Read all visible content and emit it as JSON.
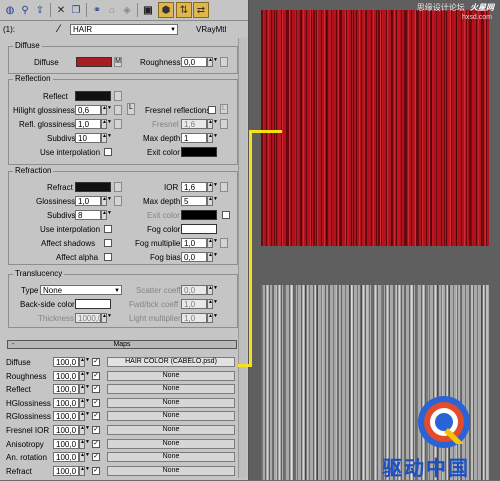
{
  "toolbar": {
    "icons": [
      "sphere-icon",
      "pick-icon",
      "put-icon",
      "delete-icon",
      "copy-icon",
      "unique-icon",
      "put-library-icon",
      "material-effects-icon",
      "show-map-icon",
      "show-end-result-icon",
      "go-parent-icon",
      "go-sibling-icon"
    ]
  },
  "material": {
    "slot": "(1):",
    "name": "HAIR",
    "type": "VRayMtl"
  },
  "diffuse": {
    "title": "Diffuse",
    "diffuse_label": "Diffuse",
    "diffuse_color": "#a61d22",
    "map_letter": "M",
    "roughness_label": "Roughness",
    "roughness_value": "0,0"
  },
  "reflection": {
    "title": "Reflection",
    "reflect_label": "Reflect",
    "reflect_color": "#111111",
    "hilight_label": "Hilight glossiness",
    "hilight_value": "0,6",
    "lock_letter": "L",
    "fresnel_label": "Fresnel reflections",
    "fresnel_lock": "L",
    "refl_gloss_label": "Refl. glossiness",
    "refl_gloss_value": "1,0",
    "fresnel_ior_label": "Fresnel IOR",
    "fresnel_ior_value": "1,6",
    "subdivs_label": "Subdivs",
    "subdivs_value": "10",
    "max_depth_label": "Max depth",
    "max_depth_value": "1",
    "use_interp_label": "Use interpolation",
    "exit_color_label": "Exit color",
    "exit_color": "#000000"
  },
  "refraction": {
    "title": "Refraction",
    "refract_label": "Refract",
    "refract_color": "#111111",
    "ior_label": "IOR",
    "ior_value": "1,6",
    "glossiness_label": "Glossiness",
    "glossiness_value": "1,0",
    "max_depth_label": "Max depth",
    "max_depth_value": "5",
    "subdivs_label": "Subdivs",
    "subdivs_value": "8",
    "exit_color_label": "Exit color",
    "exit_color": "#000000",
    "use_interp_label": "Use interpolation",
    "fog_color_label": "Fog color",
    "fog_color": "#ffffff",
    "affect_shadows_label": "Affect shadows",
    "fog_mult_label": "Fog multiplier",
    "fog_mult_value": "1,0",
    "affect_alpha_label": "Affect alpha",
    "fog_bias_label": "Fog bias",
    "fog_bias_value": "0,0"
  },
  "translucency": {
    "title": "Translucency",
    "type_label": "Type",
    "type_value": "None",
    "scatter_label": "Scatter coeff",
    "scatter_value": "0,0",
    "backside_label": "Back-side color",
    "backside_color": "#ffffff",
    "fwd_label": "Fwd/bck coeff",
    "fwd_value": "1,0",
    "thickness_label": "Thickness",
    "thickness_value": "1000,0",
    "light_mult_label": "Light multiplier",
    "light_mult_value": "1,0"
  },
  "maps": {
    "collapse": "-",
    "title": "Maps",
    "rows": [
      {
        "name": "Diffuse",
        "amount": "100,0",
        "map": "HAIR COLOR (CABELO.psd)"
      },
      {
        "name": "Roughness",
        "amount": "100,0",
        "map": "None"
      },
      {
        "name": "Reflect",
        "amount": "100,0",
        "map": "None"
      },
      {
        "name": "HGlossiness",
        "amount": "100,0",
        "map": "None"
      },
      {
        "name": "RGlossiness",
        "amount": "100,0",
        "map": "None"
      },
      {
        "name": "Fresnel IOR",
        "amount": "100,0",
        "map": "None"
      },
      {
        "name": "Anisotropy",
        "amount": "100,0",
        "map": "None"
      },
      {
        "name": "An. rotation",
        "amount": "100,0",
        "map": "None"
      },
      {
        "name": "Refract",
        "amount": "100,0",
        "map": "None"
      }
    ]
  },
  "watermark": {
    "top": "思缘设计论坛",
    "site_logo": "火星网",
    "site_url": "hxsd.com",
    "brand_cn": "驱动中国",
    "logo_letter": "Q"
  },
  "colors": {
    "highlight": "#f4e11a",
    "hair_red": "#b0121c"
  }
}
